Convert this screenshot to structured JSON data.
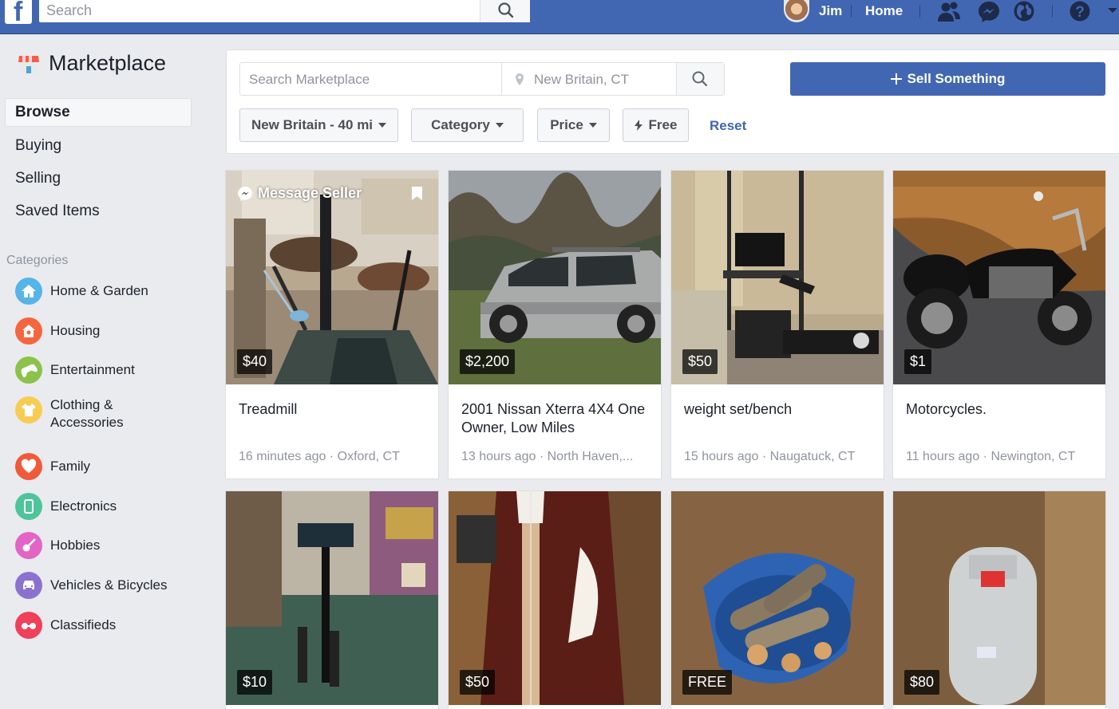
{
  "topbar": {
    "search_placeholder": "Search",
    "user_name": "Jim",
    "home_label": "Home",
    "brand_color": "#4267b2",
    "icons": [
      "friends-icon",
      "messenger-icon",
      "globe-icon",
      "help-icon",
      "dropdown-icon"
    ]
  },
  "sidebar": {
    "title": "Marketplace",
    "nav": [
      {
        "label": "Browse",
        "active": true
      },
      {
        "label": "Buying"
      },
      {
        "label": "Selling"
      },
      {
        "label": "Saved Items"
      }
    ],
    "categories_heading": "Categories",
    "categories": [
      {
        "label": "Home & Garden",
        "color": "#55b4e8",
        "icon": "house-icon"
      },
      {
        "label": "Housing",
        "color": "#f5663e",
        "icon": "key-house-icon"
      },
      {
        "label": "Entertainment",
        "color": "#8bc34a",
        "icon": "gamepad-icon"
      },
      {
        "label": "Clothing & Accessories",
        "color": "#f7cc55",
        "icon": "shirt-icon"
      },
      {
        "label": "Family",
        "color": "#f05a3a",
        "icon": "heart-icon"
      },
      {
        "label": "Electronics",
        "color": "#4dc49a",
        "icon": "phone-icon"
      },
      {
        "label": "Hobbies",
        "color": "#e364c4",
        "icon": "guitar-icon"
      },
      {
        "label": "Vehicles & Bicycles",
        "color": "#8c72cf",
        "icon": "car-icon"
      },
      {
        "label": "Classifieds",
        "color": "#f0405a",
        "icon": "glasses-icon"
      }
    ]
  },
  "search": {
    "placeholder": "Search Marketplace",
    "location": "New Britain, CT",
    "sell_label": "Sell Something"
  },
  "filters": {
    "location": "New Britain - 40 mi",
    "category": "Category",
    "price": "Price",
    "free": "Free",
    "reset": "Reset"
  },
  "listings": [
    {
      "price": "$40",
      "title": "Treadmill",
      "meta": "16 minutes ago · Oxford, CT",
      "overlay": "Message Seller"
    },
    {
      "price": "$2,200",
      "title": "2001 Nissan Xterra 4X4 One Owner, Low Miles",
      "meta": "13 hours ago · North Haven,..."
    },
    {
      "price": "$50",
      "title": "weight set/bench",
      "meta": "15 hours ago · Naugatuck, CT"
    },
    {
      "price": "$1",
      "title": "Motorcycles.",
      "meta": "11 hours ago · Newington, CT"
    },
    {
      "price": "$10"
    },
    {
      "price": "$50"
    },
    {
      "price": "FREE"
    },
    {
      "price": "$80"
    }
  ]
}
